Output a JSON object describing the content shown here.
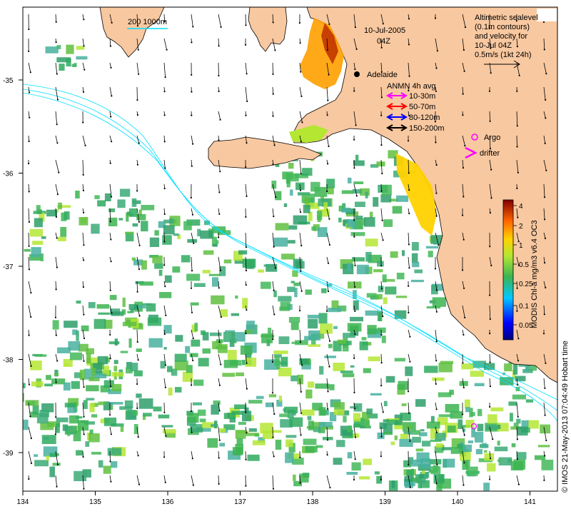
{
  "map": {
    "date_label": "10-Jul-2005",
    "time_label": "04Z",
    "city_label": "Adelaide",
    "scale_bar_label": "200 1000m",
    "sealevel_note": [
      "Altimetric sealevel",
      "(0.1m contours)",
      "and velocity for",
      "10-Jul 04Z",
      "0.5m/s (1kt 24h)"
    ],
    "anmn": {
      "title": "ANMN 4h avg",
      "items": [
        {
          "label": "10-30m",
          "color": "#ff00ff"
        },
        {
          "label": "50-70m",
          "color": "#ff0000"
        },
        {
          "label": "80-120m",
          "color": "#0000ff"
        },
        {
          "label": "150-200m",
          "color": "#000000"
        }
      ]
    },
    "argo_label": "Argo",
    "drifter_label": "drifter",
    "colorbar": {
      "title": "MODIS Chl-a mg/m3 v6.4 OC3",
      "ticks": [
        "4",
        "2",
        "1",
        "0.5",
        "0.25",
        "0.1",
        "0.05"
      ]
    },
    "x_ticks": [
      "134",
      "135",
      "136",
      "137",
      "138",
      "139",
      "140",
      "141"
    ],
    "y_ticks": [
      "-35",
      "-36",
      "-37",
      "-38",
      "-39"
    ],
    "credit": "© IMOS 21-May-2013 07:04:49 Hobart time",
    "colors": {
      "land": "#f8c8a0",
      "shelf": "#00e0ff",
      "chl_mid": "#3cb450",
      "argo": "#ff00ff"
    }
  }
}
